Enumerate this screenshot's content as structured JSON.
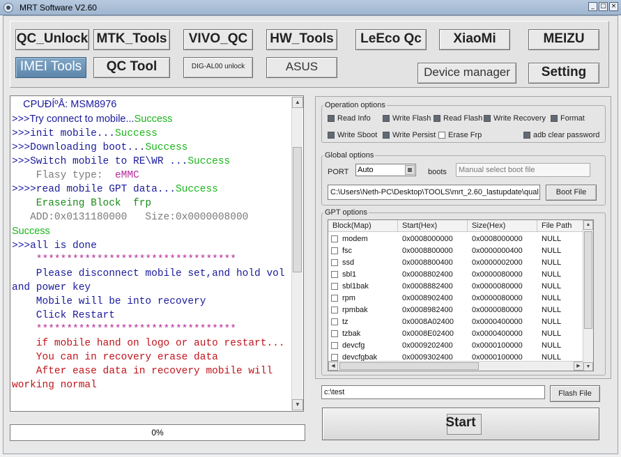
{
  "window": {
    "title": "MRT Software V2.60",
    "controls": [
      "_",
      "□",
      "×"
    ]
  },
  "nav": {
    "qc_unlock": "QC_Unlock",
    "mtk_tools": "MTK_Tools",
    "vivo_qc": "VIVO_QC",
    "hw_tools": "HW_Tools",
    "leeco_qc": "LeEco Qc",
    "xiaomi": "XiaoMi",
    "meizu": "MEIZU",
    "imei_tools": "IMEI Tools",
    "qc_tool": "QC Tool",
    "dig_al00": "DIG-AL00 unlock",
    "asus": "ASUS",
    "device_manager": "Device manager",
    "setting": "Setting"
  },
  "log": {
    "l1": "    CPUÐÍºÅ: MSM8976",
    "l2a": ">>>Try connect to mobile...",
    "l2b": "Success",
    "l3a": ">>>init mobile...",
    "l3b": "Success",
    "l4a": ">>>Downloading boot...",
    "l4b": "Success",
    "l5a": ">>>Switch mobile to RE\\WR ...",
    "l5b": "Success",
    "l6a": "    Flasy type:  ",
    "l6b": "eMMC",
    "l7a": ">>>>read mobile GPT data...",
    "l7b": "Success",
    "l8": "    Eraseing Block  frp",
    "l9": "   ADD:0x0131180000   Size:0x0000008000",
    "l10": "Success",
    "l11": ">>>all is done",
    "l12": "    *********************************",
    "l13": "    Please disconnect mobile set,and hold vol up",
    "l14": "and power key",
    "l15": "    Mobile will be into recovery",
    "l16": "    Click Restart",
    "l17": "    *********************************",
    "l18": "    if mobile hand on logo or auto restart...",
    "l19": "    You can in recovery erase data",
    "l20": "    After ease data in recovery mobile will",
    "l21": "working normal"
  },
  "progress": {
    "label": "0%",
    "value": 0
  },
  "operation_options": {
    "legend": "Operation options",
    "read_info": "Read Info",
    "write_flash": "Write Flash",
    "read_flash": "Read Flash",
    "write_recovery": "Write Recovery",
    "format": "Format",
    "write_sboot": "Write Sboot",
    "write_persist": "Write Persist",
    "erase_frp": "Erase Frp",
    "adb_clear": "adb clear password"
  },
  "global_options": {
    "legend": "Global options",
    "port_label": "PORT",
    "port_value": "Auto",
    "boots_label": "boots",
    "boot_placeholder": "Manual select boot file",
    "path_value": "C:\\Users\\Neth-PC\\Desktop\\TOOLS\\mrt_2.60_lastupdate\\qual",
    "boot_file_button": "Boot File"
  },
  "gpt": {
    "legend": "GPT options",
    "columns": [
      "Block(Map)",
      "Start(Hex)",
      "Size(Hex)",
      "File Path"
    ],
    "rows": [
      [
        "modem",
        "0x0008000000",
        "0x0008000000",
        "NULL"
      ],
      [
        "fsc",
        "0x0008800000",
        "0x0000000400",
        "NULL"
      ],
      [
        "ssd",
        "0x0008800400",
        "0x0000002000",
        "NULL"
      ],
      [
        "sbl1",
        "0x0008802400",
        "0x0000080000",
        "NULL"
      ],
      [
        "sbl1bak",
        "0x0008882400",
        "0x0000080000",
        "NULL"
      ],
      [
        "rpm",
        "0x0008902400",
        "0x0000080000",
        "NULL"
      ],
      [
        "rpmbak",
        "0x0008982400",
        "0x0000080000",
        "NULL"
      ],
      [
        "tz",
        "0x0008A02400",
        "0x0000400000",
        "NULL"
      ],
      [
        "tzbak",
        "0x0008E02400",
        "0x0000400000",
        "NULL"
      ],
      [
        "devcfg",
        "0x0009202400",
        "0x0000100000",
        "NULL"
      ],
      [
        "devcfgbak",
        "0x0009302400",
        "0x0000100000",
        "NULL"
      ]
    ]
  },
  "flash": {
    "path": "c:\\test",
    "button": "Flash File"
  },
  "start_button": "Start"
}
